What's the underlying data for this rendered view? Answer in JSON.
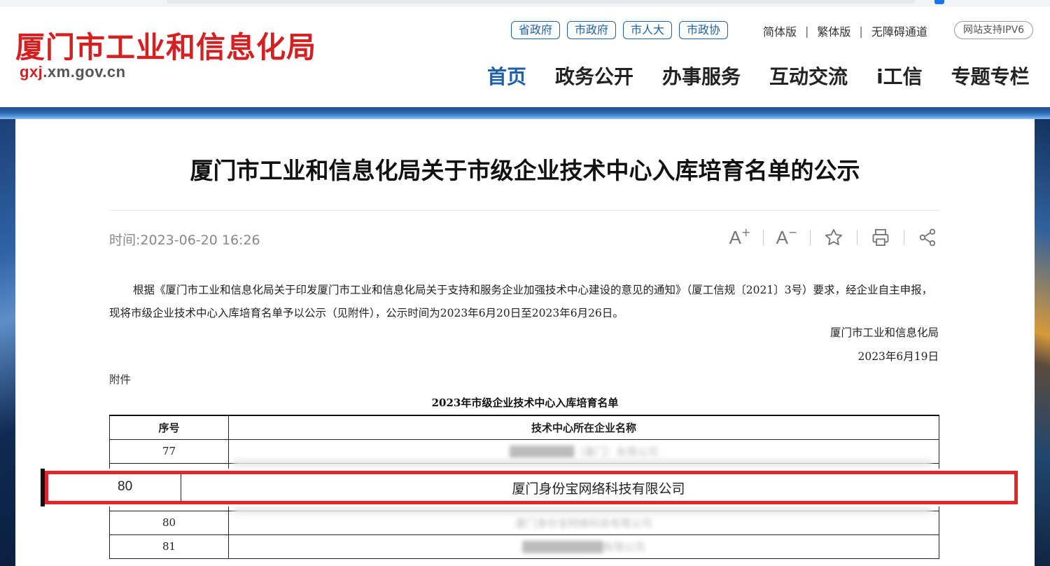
{
  "site": {
    "name": "厦门市工业和信息化局",
    "url_prefix": "gxj",
    "url_suffix": ".xm.gov.cn"
  },
  "quick_links": [
    "省政府",
    "市政府",
    "市人大",
    "市政协"
  ],
  "utils": {
    "simplified": "简体版",
    "traditional": "繁体版",
    "accessibility": "无障碍通道",
    "ipv6": "网站支持IPV6",
    "separator": "|"
  },
  "nav": [
    "首页",
    "政务公开",
    "办事服务",
    "互动交流",
    "i工信",
    "专题专栏"
  ],
  "article": {
    "title": "厦门市工业和信息化局关于市级企业技术中心入库培育名单的公示",
    "time": "时间:2023-06-20 16:26",
    "body": "根据《厦门市工业和信息化局关于印发厦门市工业和信息化局关于支持和服务企业加强技术中心建设的意见的通知》（厦工信规〔2021〕3号）要求，经企业自主申报，现将市级企业技术中心入库培育名单予以公示（见附件），公示时间为2023年6月20日至2023年6月26日。",
    "signature": "厦门市工业和信息化局",
    "date": "2023年6月19日",
    "attachment_label": "附件"
  },
  "tools": {
    "font_increase": "A",
    "font_decrease": "A",
    "plus": "+",
    "minus": "−"
  },
  "table": {
    "title": "2023年市级企业技术中心入库培育名单",
    "headers": [
      "序号",
      "技术中心所在企业名称"
    ],
    "rows": [
      {
        "seq": "77",
        "name": "████████（厦门）有限公司"
      },
      {
        "seq": "80",
        "name": "厦门身份宝网络科技有限公司"
      },
      {
        "seq": "81",
        "name": "██████████有限公司"
      }
    ]
  },
  "highlight": {
    "seq": "80",
    "name": "厦门身份宝网络科技有限公司"
  },
  "colors": {
    "brand_red": "#d42020",
    "brand_blue": "#1d5fa8",
    "highlight_border": "#e0252b"
  }
}
